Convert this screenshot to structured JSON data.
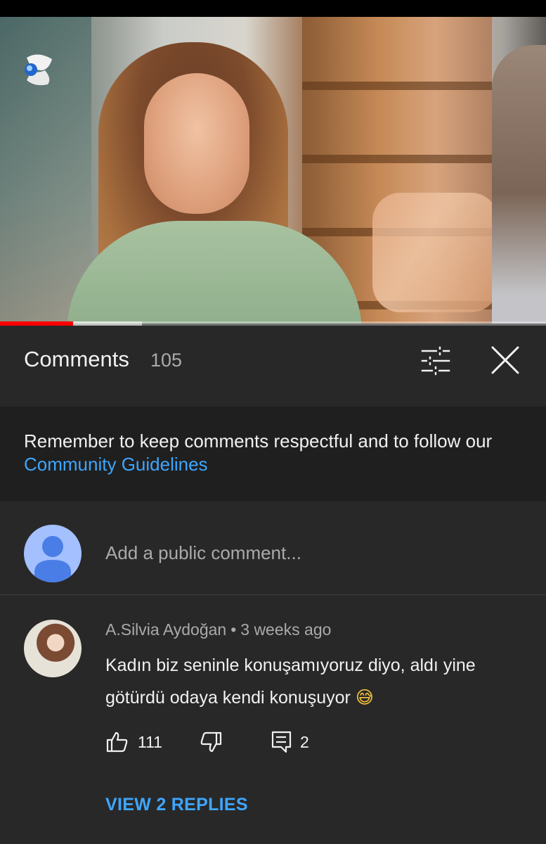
{
  "video": {
    "progress_fraction": 0.134,
    "buffered_fraction": 0.26,
    "accent_color": "#ff0000"
  },
  "header": {
    "title": "Comments",
    "count": "105",
    "filter_icon": "sort-filter-icon",
    "close_icon": "close-icon"
  },
  "guidelines": {
    "text": "Remember to keep comments respectful and to follow our ",
    "link": "Community Guidelines",
    "link_color": "#3ea6ff"
  },
  "add_comment": {
    "placeholder": "Add a public comment..."
  },
  "comments": [
    {
      "author": "A.Silvia Aydoğan",
      "separator": "•",
      "time": "3 weeks ago",
      "text": "Kadın biz seninle konuşamıyoruz diyo, aldı yine götürdü odaya kendi konuşuyor",
      "emoji": "😅",
      "likes": "111",
      "replies_count": "2",
      "view_replies": "VIEW 2 REPLIES"
    }
  ]
}
